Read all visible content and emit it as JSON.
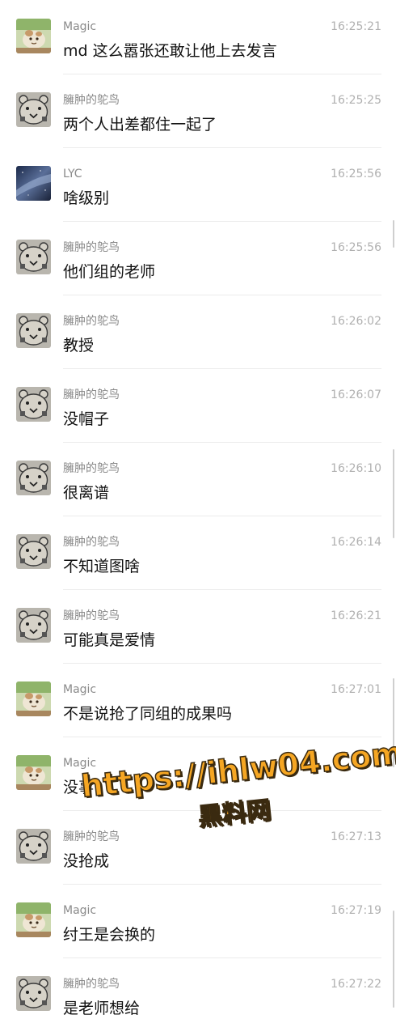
{
  "messages": [
    {
      "avatar": "magic",
      "sender": "Magic",
      "time": "16:25:21",
      "text": "md 这么嚣张还敢让他上去发言"
    },
    {
      "avatar": "bear",
      "sender": "臃肿的鸵鸟",
      "time": "16:25:25",
      "text": "两个人出差都住一起了"
    },
    {
      "avatar": "sky",
      "sender": "LYC",
      "time": "16:25:56",
      "text": "啥级别"
    },
    {
      "avatar": "bear",
      "sender": "臃肿的鸵鸟",
      "time": "16:25:56",
      "text": "他们组的老师"
    },
    {
      "avatar": "bear",
      "sender": "臃肿的鸵鸟",
      "time": "16:26:02",
      "text": "教授"
    },
    {
      "avatar": "bear",
      "sender": "臃肿的鸵鸟",
      "time": "16:26:07",
      "text": "没帽子"
    },
    {
      "avatar": "bear",
      "sender": "臃肿的鸵鸟",
      "time": "16:26:10",
      "text": "很离谱"
    },
    {
      "avatar": "bear",
      "sender": "臃肿的鸵鸟",
      "time": "16:26:14",
      "text": "不知道图啥"
    },
    {
      "avatar": "bear",
      "sender": "臃肿的鸵鸟",
      "time": "16:26:21",
      "text": "可能真是爱情"
    },
    {
      "avatar": "magic",
      "sender": "Magic",
      "time": "16:27:01",
      "text": "不是说抢了同组的成果吗"
    },
    {
      "avatar": "magic",
      "sender": "Magic",
      "time": "",
      "text": "没事"
    },
    {
      "avatar": "bear",
      "sender": "臃肿的鸵鸟",
      "time": "16:27:13",
      "text": "没抢成"
    },
    {
      "avatar": "magic",
      "sender": "Magic",
      "time": "16:27:19",
      "text": "纣王是会换的"
    },
    {
      "avatar": "bear",
      "sender": "臃肿的鸵鸟",
      "time": "16:27:22",
      "text": "是老师想给"
    }
  ],
  "watermark": {
    "url": "https://ihlw04.com",
    "name": "黑料网",
    "color": "#f5a623"
  },
  "colors": {
    "sender": "#8a8a8a",
    "time": "#b0b0b0",
    "message": "#111111",
    "divider": "#ececec"
  }
}
